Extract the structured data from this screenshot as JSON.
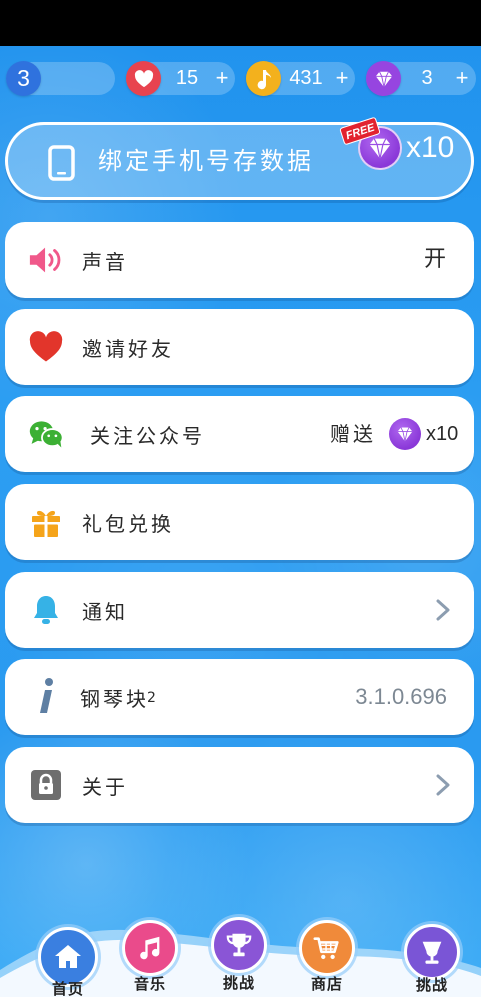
{
  "top_bar": {
    "level": "3",
    "hearts": {
      "value": "15",
      "plus": "+",
      "icon": "heart-icon"
    },
    "notes": {
      "value": "431",
      "plus": "+",
      "icon": "music-note-icon"
    },
    "diamonds": {
      "value": "3",
      "plus": "+",
      "icon": "diamond-icon"
    }
  },
  "bind_phone": {
    "label": "绑定手机号存数据",
    "badge": "FREE",
    "reward": "x10",
    "icon": "phone-icon"
  },
  "settings": [
    {
      "label": "声音",
      "value": "开",
      "icon": "speaker-icon"
    },
    {
      "label": "邀请好友",
      "icon": "heart-icon"
    },
    {
      "label": "关注公众号",
      "gift_label": "赠送",
      "reward": "x10",
      "icon": "wechat-icon"
    },
    {
      "label": "礼包兑换",
      "icon": "gift-icon"
    },
    {
      "label": "通知",
      "icon": "bell-icon"
    },
    {
      "label": "钢琴块",
      "label_suffix": "2",
      "value": "3.1.0.696",
      "icon": "info-icon"
    },
    {
      "label": "关于",
      "icon": "lock-icon"
    }
  ],
  "nav": [
    {
      "label": "首页",
      "icon": "home-icon"
    },
    {
      "label": "音乐",
      "icon": "music-icon"
    },
    {
      "label": "挑战",
      "icon": "trophy-icon"
    },
    {
      "label": "商店",
      "icon": "cart-icon"
    },
    {
      "label": "挑战",
      "icon": "goblet-icon"
    }
  ],
  "colors": {
    "background": "#2a9af0",
    "level": "#2f72de",
    "heart": "#e8434f",
    "note": "#f3b11d",
    "diamond": "#9645e0",
    "nav_home": "#3a7fe0",
    "nav_music": "#ea4b8b",
    "nav_challenge": "#8a55d6",
    "nav_shop": "#f08a3a"
  }
}
